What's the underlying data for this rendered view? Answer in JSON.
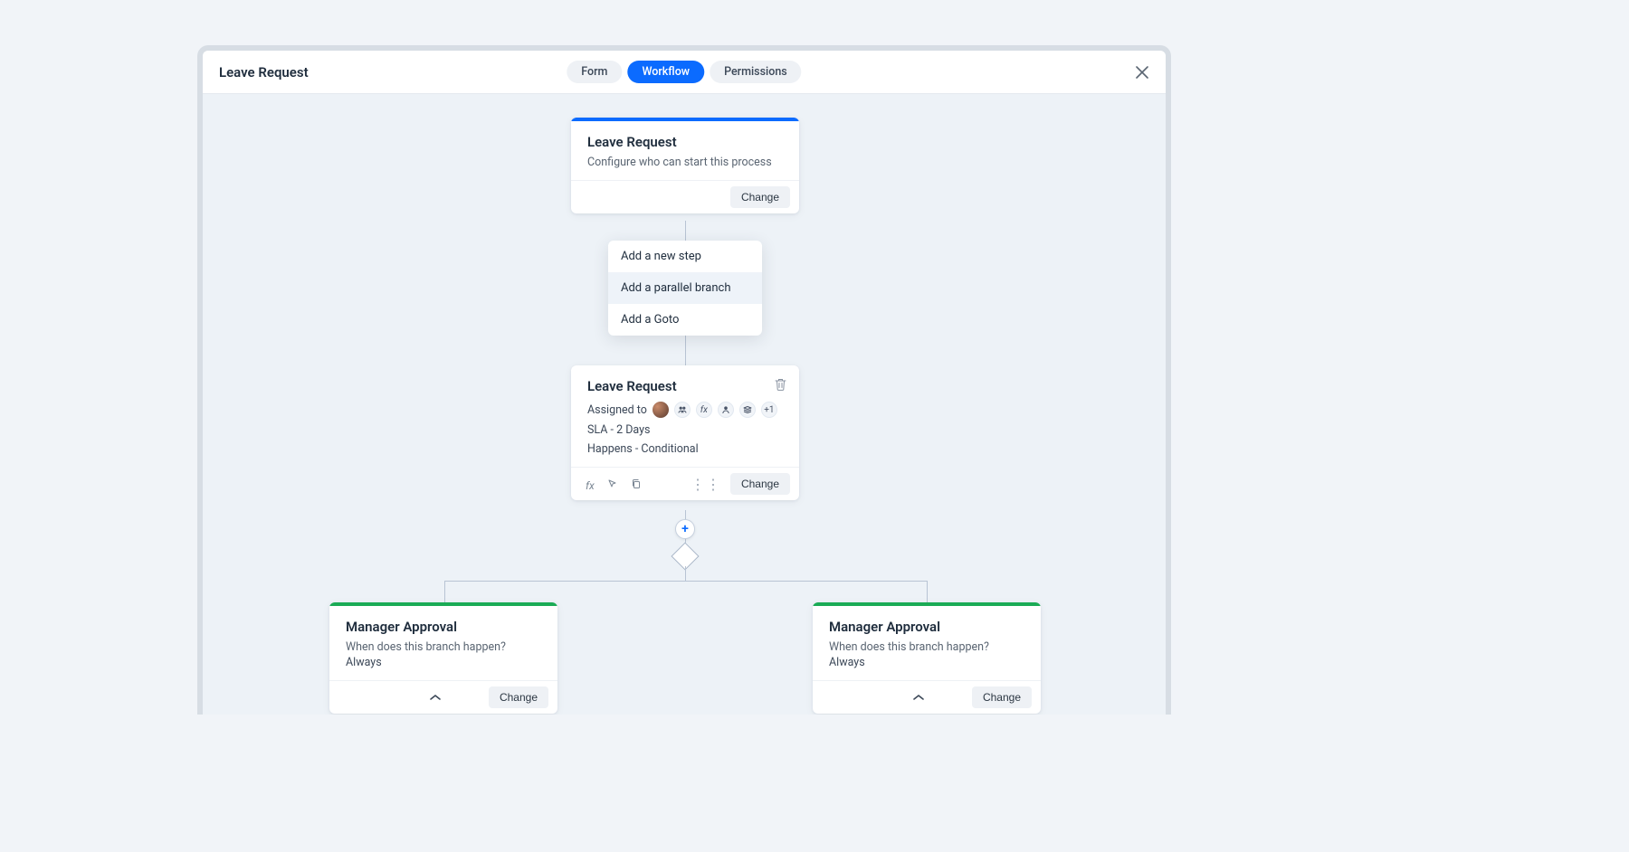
{
  "header": {
    "title": "Leave Request",
    "tabs": {
      "form": "Form",
      "workflow": "Workflow",
      "permissions": "Permissions"
    }
  },
  "startCard": {
    "title": "Leave Request",
    "subtitle": "Configure who can start this process",
    "changeLabel": "Change"
  },
  "popover": {
    "addStep": "Add a new step",
    "addBranch": "Add a parallel branch",
    "addGoto": "Add a Goto"
  },
  "stepCard": {
    "title": "Leave Request",
    "assignedLabel": "Assigned to",
    "extraCount": "+1",
    "sla": "SLA - 2 Days",
    "happens": "Happens - Conditional",
    "changeLabel": "Change"
  },
  "branchLeft": {
    "title": "Manager Approval",
    "question": "When does this branch happen?",
    "answer": "Always",
    "changeLabel": "Change"
  },
  "branchRight": {
    "title": "Manager Approval",
    "question": "When does this branch happen?",
    "answer": "Always",
    "changeLabel": "Change"
  }
}
